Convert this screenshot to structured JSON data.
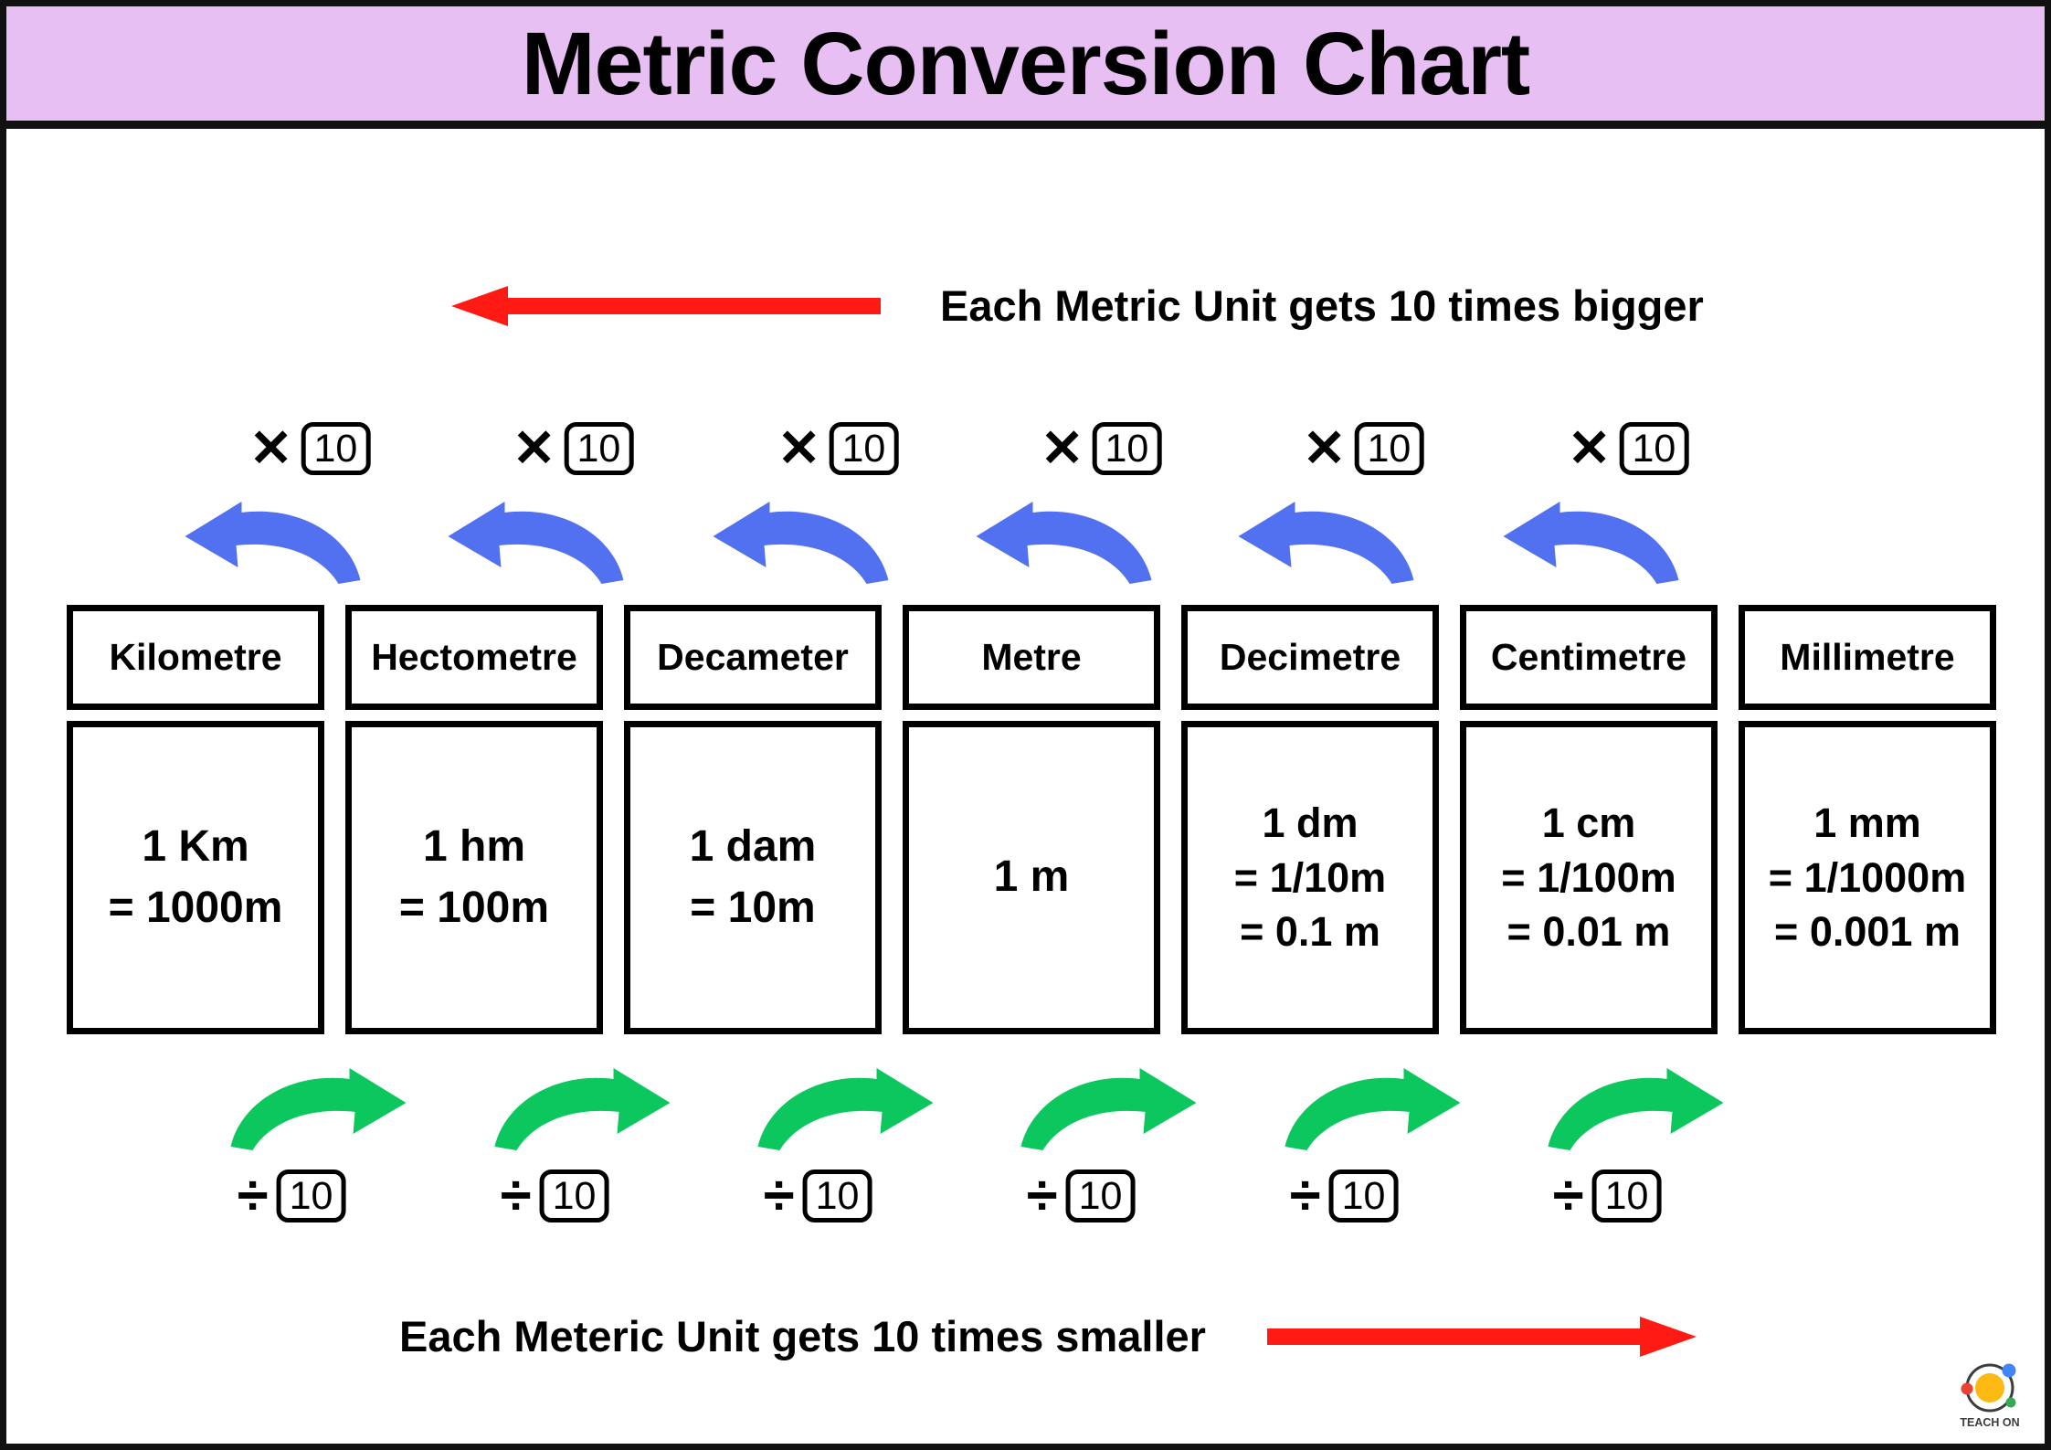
{
  "title": "Metric Conversion Chart",
  "colors": {
    "banner_bg": "#E8BFF2",
    "red_arrow": "#FF1A14",
    "blue_arrow": "#5271F0",
    "green_arrow": "#0BC75E",
    "border": "#000000"
  },
  "top_note": {
    "caption": "Each Metric Unit gets 10 times bigger",
    "arrow_direction": "left",
    "arrow_color": "#FF1A14"
  },
  "bottom_note": {
    "caption": "Each Meteric Unit gets 10 times smaller",
    "arrow_direction": "right",
    "arrow_color": "#FF1A14"
  },
  "multiply_row": {
    "sign": "✕",
    "factor": "10",
    "count": 6,
    "arrow_color": "#5271F0",
    "arrow_direction": "left"
  },
  "divide_row": {
    "sign": "÷",
    "factor": "10",
    "count": 6,
    "arrow_color": "#0BC75E",
    "arrow_direction": "right"
  },
  "units": [
    {
      "name": "Kilometre",
      "lines": [
        "1 Km",
        "= 1000m"
      ]
    },
    {
      "name": "Hectometre",
      "lines": [
        "1 hm",
        "= 100m"
      ]
    },
    {
      "name": "Decameter",
      "lines": [
        "1 dam",
        "= 10m"
      ]
    },
    {
      "name": "Metre",
      "lines": [
        "1 m"
      ]
    },
    {
      "name": "Decimetre",
      "lines": [
        "1 dm",
        "= 1/10m",
        "= 0.1 m"
      ]
    },
    {
      "name": "Centimetre",
      "lines": [
        "1 cm",
        "= 1/100m",
        "= 0.01 m"
      ]
    },
    {
      "name": "Millimetre",
      "lines": [
        "1 mm",
        "= 1/1000m",
        "= 0.001 m"
      ]
    }
  ],
  "logo": {
    "text": "TEACH ON",
    "center_color": "#FDB913",
    "ring_color": "#3C3C3C",
    "dot_red": "#EA4335",
    "dot_blue": "#4285F4",
    "dot_green": "#34A853"
  }
}
